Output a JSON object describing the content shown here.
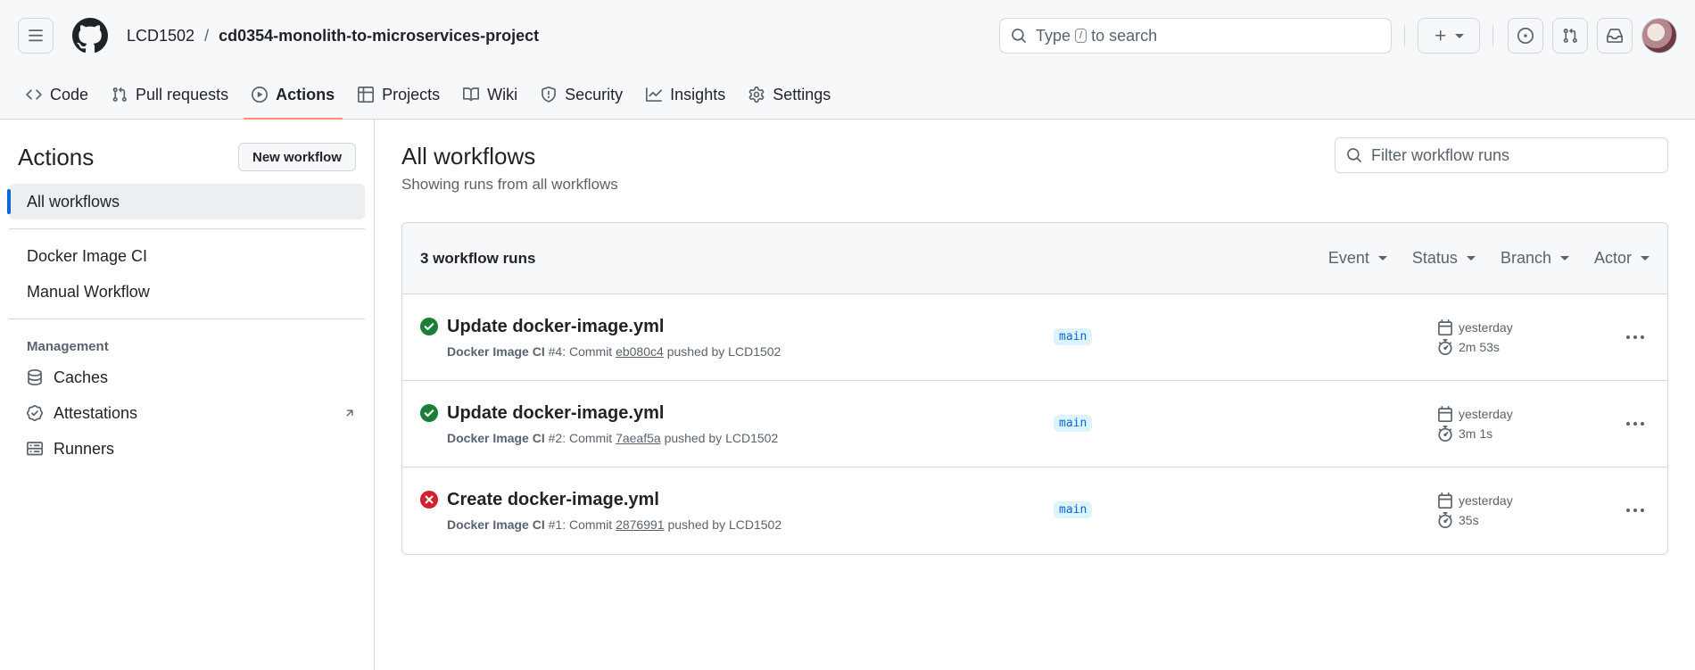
{
  "header": {
    "owner": "LCD1502",
    "separator": "/",
    "repo": "cd0354-monolith-to-microservices-project",
    "search": {
      "before": "Type",
      "key": "/",
      "after": "to search"
    }
  },
  "tabs": [
    {
      "label": "Code",
      "icon": "code-icon"
    },
    {
      "label": "Pull requests",
      "icon": "git-pull-request-icon"
    },
    {
      "label": "Actions",
      "icon": "play-icon",
      "active": true
    },
    {
      "label": "Projects",
      "icon": "table-icon"
    },
    {
      "label": "Wiki",
      "icon": "book-icon"
    },
    {
      "label": "Security",
      "icon": "shield-icon"
    },
    {
      "label": "Insights",
      "icon": "graph-icon"
    },
    {
      "label": "Settings",
      "icon": "gear-icon"
    }
  ],
  "sidebar": {
    "title": "Actions",
    "new_workflow": "New workflow",
    "all_workflows": "All workflows",
    "workflows": [
      "Docker Image CI",
      "Manual Workflow"
    ],
    "management_label": "Management",
    "management": [
      {
        "label": "Caches",
        "icon": "database-icon"
      },
      {
        "label": "Attestations",
        "icon": "verified-icon"
      },
      {
        "label": "Runners",
        "icon": "server-icon"
      }
    ]
  },
  "main": {
    "title": "All workflows",
    "subtitle": "Showing runs from all workflows",
    "filter_placeholder": "Filter workflow runs",
    "count": "3 workflow runs",
    "filters": [
      "Event",
      "Status",
      "Branch",
      "Actor"
    ],
    "runs": [
      {
        "title": "Update docker-image.yml",
        "status": "success",
        "workflow": "Docker Image CI",
        "number": "#4",
        "commit_prefix": ": Commit",
        "sha": "eb080c4",
        "pushed": "pushed by LCD1502",
        "branch": "main",
        "when": "yesterday",
        "duration": "2m 53s"
      },
      {
        "title": "Update docker-image.yml",
        "status": "success",
        "workflow": "Docker Image CI",
        "number": "#2",
        "commit_prefix": ": Commit",
        "sha": "7aeaf5a",
        "pushed": "pushed by LCD1502",
        "branch": "main",
        "when": "yesterday",
        "duration": "3m 1s"
      },
      {
        "title": "Create docker-image.yml",
        "status": "failure",
        "workflow": "Docker Image CI",
        "number": "#1",
        "commit_prefix": ": Commit",
        "sha": "2876991",
        "pushed": "pushed by LCD1502",
        "branch": "main",
        "when": "yesterday",
        "duration": "35s"
      }
    ]
  },
  "colors": {
    "success": "#1a7f37",
    "failure": "#cf222e",
    "accent": "#0969da",
    "active_tab_underline": "#fd8c73"
  }
}
